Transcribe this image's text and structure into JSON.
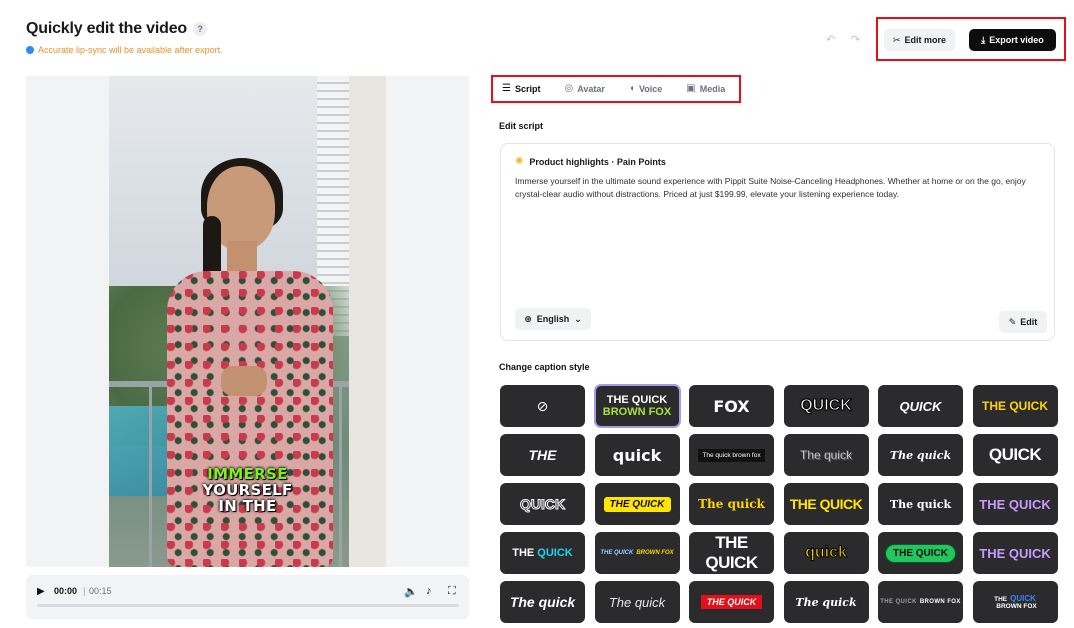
{
  "header": {
    "title": "Quickly edit the video",
    "notice": "Accurate lip-sync will be available after export.",
    "undo_icon": "↶",
    "redo_icon": "↷",
    "edit_more_label": "Edit more",
    "export_label": "Export video"
  },
  "video": {
    "caption_line1": "IMMERSE",
    "caption_line2": "YOURSELF",
    "caption_line3": "IN THE"
  },
  "player": {
    "current_time": "00:00",
    "separator": "|",
    "total_time": "00:15",
    "progress": 0
  },
  "tabs": [
    {
      "label": "Script",
      "icon": "script-icon",
      "active": true
    },
    {
      "label": "Avatar",
      "icon": "avatar-icon",
      "active": false
    },
    {
      "label": "Voice",
      "icon": "voice-icon",
      "active": false
    },
    {
      "label": "Media",
      "icon": "media-icon",
      "active": false
    }
  ],
  "edit_script": {
    "section_label": "Edit script",
    "heading": "Product highlights · Pain Points",
    "body": "Immerse yourself in the ultimate sound experience with Pippit Suite Noise-Canceling Headphones. Whether at home or on the go, enjoy crystal-clear audio without distractions. Priced at just $199.99, elevate your listening experience today.",
    "language": "English",
    "edit_label": "Edit"
  },
  "caption_style": {
    "section_label": "Change caption style",
    "tiles": [
      {
        "text": "⊘",
        "style": "none"
      },
      {
        "text": "THE QUICK",
        "text2": "BROWN FOX",
        "style": "green-two",
        "selected": true
      },
      {
        "text": "FOX",
        "style": "white-bold"
      },
      {
        "text": "QUICK",
        "style": "outline"
      },
      {
        "text": "QUICK",
        "style": "italic"
      },
      {
        "text": "THE QUICK",
        "style": "yellow"
      },
      {
        "text": "THE",
        "style": "italic-big"
      },
      {
        "text": "quick",
        "style": "white-bold"
      },
      {
        "text": "The quick brown fox",
        "style": "white-box"
      },
      {
        "text": "The quick",
        "style": "white-shadow"
      },
      {
        "text": "The quick",
        "style": "serif-italic"
      },
      {
        "text": "QUICK",
        "style": "condensed"
      },
      {
        "text": "QUICK",
        "style": "stroked"
      },
      {
        "text": "THE QUICK",
        "style": "yellow-box"
      },
      {
        "text": "The quick",
        "style": "quick-yellow-serif"
      },
      {
        "text": "THE QUICK",
        "style": "condensed-yellow"
      },
      {
        "text": "The quick",
        "style": "serif"
      },
      {
        "text": "THE QUICK",
        "style": "purple"
      },
      {
        "text": "THE",
        "text2": "QUICK",
        "style": "cyan-mix"
      },
      {
        "text": "THE QUICK",
        "text2": "BROWN FOX",
        "style": "tiny-yellow"
      },
      {
        "text": "THE QUICK",
        "style": "condensed"
      },
      {
        "text": "quick",
        "style": "quick-yellow"
      },
      {
        "text": "THE QUICK",
        "style": "green-box"
      },
      {
        "text": "THE QUICK",
        "style": "purple"
      },
      {
        "text": "The quick",
        "style": "italic-big"
      },
      {
        "text": "The quick",
        "style": "italic-light"
      },
      {
        "text": "THE QUICK",
        "style": "red-box"
      },
      {
        "text": "The quick",
        "style": "serif-italic"
      },
      {
        "text": "THE QUICK",
        "text2": "BROWN FOX",
        "style": "gray"
      },
      {
        "text": "THE",
        "text2": "QUICK",
        "text3": "BROWN FOX",
        "style": "blue-mix"
      }
    ]
  },
  "colors": {
    "accent_red": "#e3101a",
    "notice_orange": "#e8922b",
    "export_bg": "#0d0d0d",
    "selected_outline": "#a79be8"
  }
}
